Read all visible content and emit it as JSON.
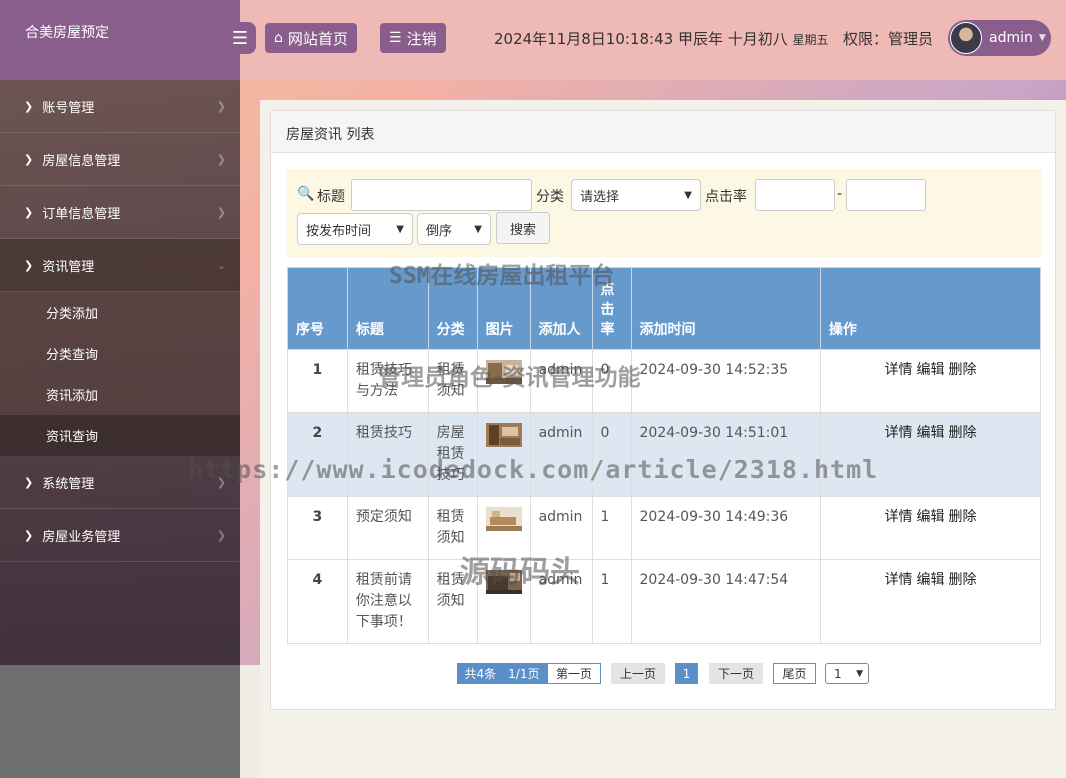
{
  "brand": {
    "title": "合美房屋预定"
  },
  "topbar": {
    "home_label": "网站首页",
    "logout_label": "注销",
    "datetime": "2024年11月8日10:18:43 甲辰年 十月初八",
    "weekday": "星期五",
    "permission": "权限：管理员",
    "username": "admin"
  },
  "sidebar": {
    "items": [
      {
        "label": "账号管理"
      },
      {
        "label": "房屋信息管理"
      },
      {
        "label": "订单信息管理"
      },
      {
        "label": "资讯管理"
      },
      {
        "label": "系统管理"
      },
      {
        "label": "房屋业务管理"
      }
    ],
    "sub_items": [
      {
        "label": "分类添加"
      },
      {
        "label": "分类查询"
      },
      {
        "label": "资讯添加"
      },
      {
        "label": "资讯查询"
      }
    ]
  },
  "panel": {
    "title": "房屋资讯 列表"
  },
  "search": {
    "title_label": "标题",
    "title_value": "",
    "category_label": "分类",
    "category_selected": "请选择",
    "clicks_label": "点击率",
    "clicks_min": "",
    "range_sep": "-",
    "clicks_max": "",
    "sort_selected": "按发布时间",
    "order_selected": "倒序",
    "search_button": "搜索"
  },
  "table": {
    "headers": [
      "序号",
      "标题",
      "分类",
      "图片",
      "添加人",
      "点击率",
      "添加时间",
      "操作"
    ],
    "rows": [
      {
        "no": "1",
        "title": "租赁技巧与方法",
        "category": "租赁须知",
        "adder": "admin",
        "clicks": "0",
        "time": "2024-09-30 14:52:35"
      },
      {
        "no": "2",
        "title": "租赁技巧",
        "category": "房屋租赁技巧",
        "adder": "admin",
        "clicks": "0",
        "time": "2024-09-30 14:51:01"
      },
      {
        "no": "3",
        "title": "预定须知",
        "category": "租赁须知",
        "adder": "admin",
        "clicks": "1",
        "time": "2024-09-30 14:49:36"
      },
      {
        "no": "4",
        "title": "租赁前请你注意以下事项！",
        "category": "租赁须知",
        "adder": "admin",
        "clicks": "1",
        "time": "2024-09-30 14:47:54"
      }
    ],
    "ops": {
      "detail": "详情",
      "edit": "编辑",
      "delete": "删除"
    }
  },
  "pagination": {
    "total": "共4条　1/1页",
    "first": "第一页",
    "prev": "上一页",
    "current": "1",
    "next": "下一页",
    "last": "尾页",
    "page_select": "1"
  },
  "watermarks": {
    "w1": "SSM在线房屋出租平台",
    "w2": "管理员角色-资讯管理功能",
    "w3": "https://www.icodedock.com/article/2318.html",
    "w4": "源码码头"
  },
  "colors": {
    "accent": "#8a5e8c",
    "header_bg": "#efbab5",
    "table_head": "#6699cc",
    "search_bg": "#fcf8e3"
  },
  "icons": {
    "toggle": "menu-icon",
    "home": "home-icon",
    "logout": "list-icon",
    "search": "search-icon"
  }
}
